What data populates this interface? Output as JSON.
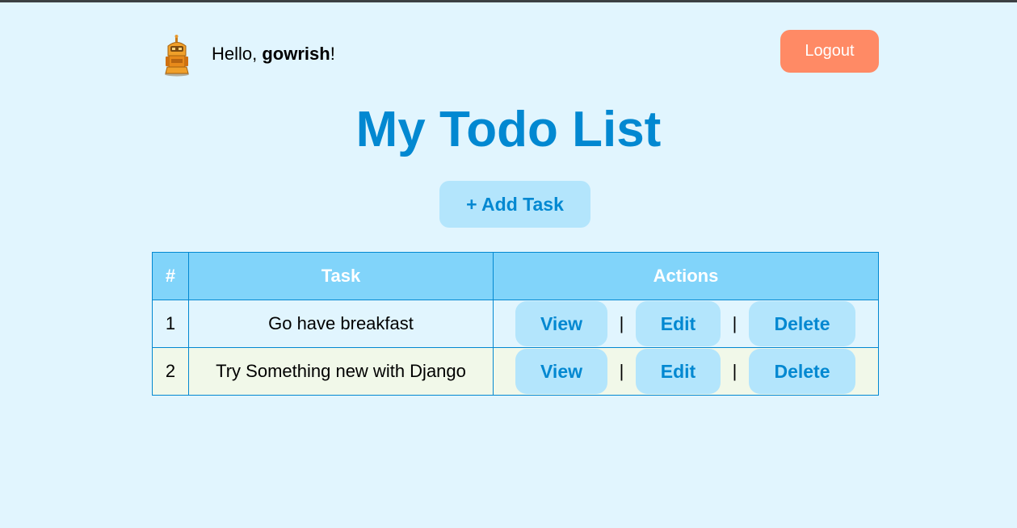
{
  "header": {
    "greeting_prefix": "Hello, ",
    "username": "gowrish",
    "greeting_suffix": "!",
    "logout_label": "Logout"
  },
  "page": {
    "title": "My Todo List",
    "add_task_label": "+ Add Task"
  },
  "table": {
    "columns": [
      "#",
      "Task",
      "Actions"
    ],
    "rows": [
      {
        "num": "1",
        "task": "Go have breakfast",
        "view": "View",
        "edit": "Edit",
        "delete": "Delete"
      },
      {
        "num": "2",
        "task": "Try Something new with Django",
        "view": "View",
        "edit": "Edit",
        "delete": "Delete"
      }
    ],
    "separator": "|"
  },
  "colors": {
    "background": "#e1f5fe",
    "accent": "#0288d1",
    "header_row": "#81d4fa",
    "button_bg": "#b3e5fc",
    "logout_bg": "#ff8a65",
    "alt_row": "#f1f8e9"
  },
  "icons": {
    "avatar": "robot-avatar-icon"
  }
}
